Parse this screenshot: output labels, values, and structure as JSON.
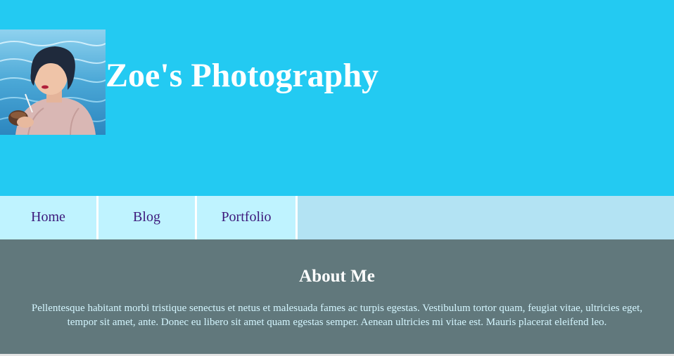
{
  "header": {
    "title": "Zoe's Photography",
    "background_color": "#23caf2",
    "avatar_icon": "profile-photo"
  },
  "nav": {
    "items": [
      {
        "label": "Home"
      },
      {
        "label": "Blog"
      },
      {
        "label": "Portfolio"
      }
    ],
    "item_color": "#3d1a7c",
    "item_background": "#bff3ff"
  },
  "about": {
    "heading": "About Me",
    "body": "Pellentesque habitant morbi tristique senectus et netus et malesuada fames ac turpis egestas. Vestibulum tortor quam, feugiat vitae, ultricies eget, tempor sit amet, ante. Donec eu libero sit amet quam egestas semper. Aenean ultricies mi vitae est. Mauris placerat eleifend leo.",
    "background_color": "#61787c"
  }
}
